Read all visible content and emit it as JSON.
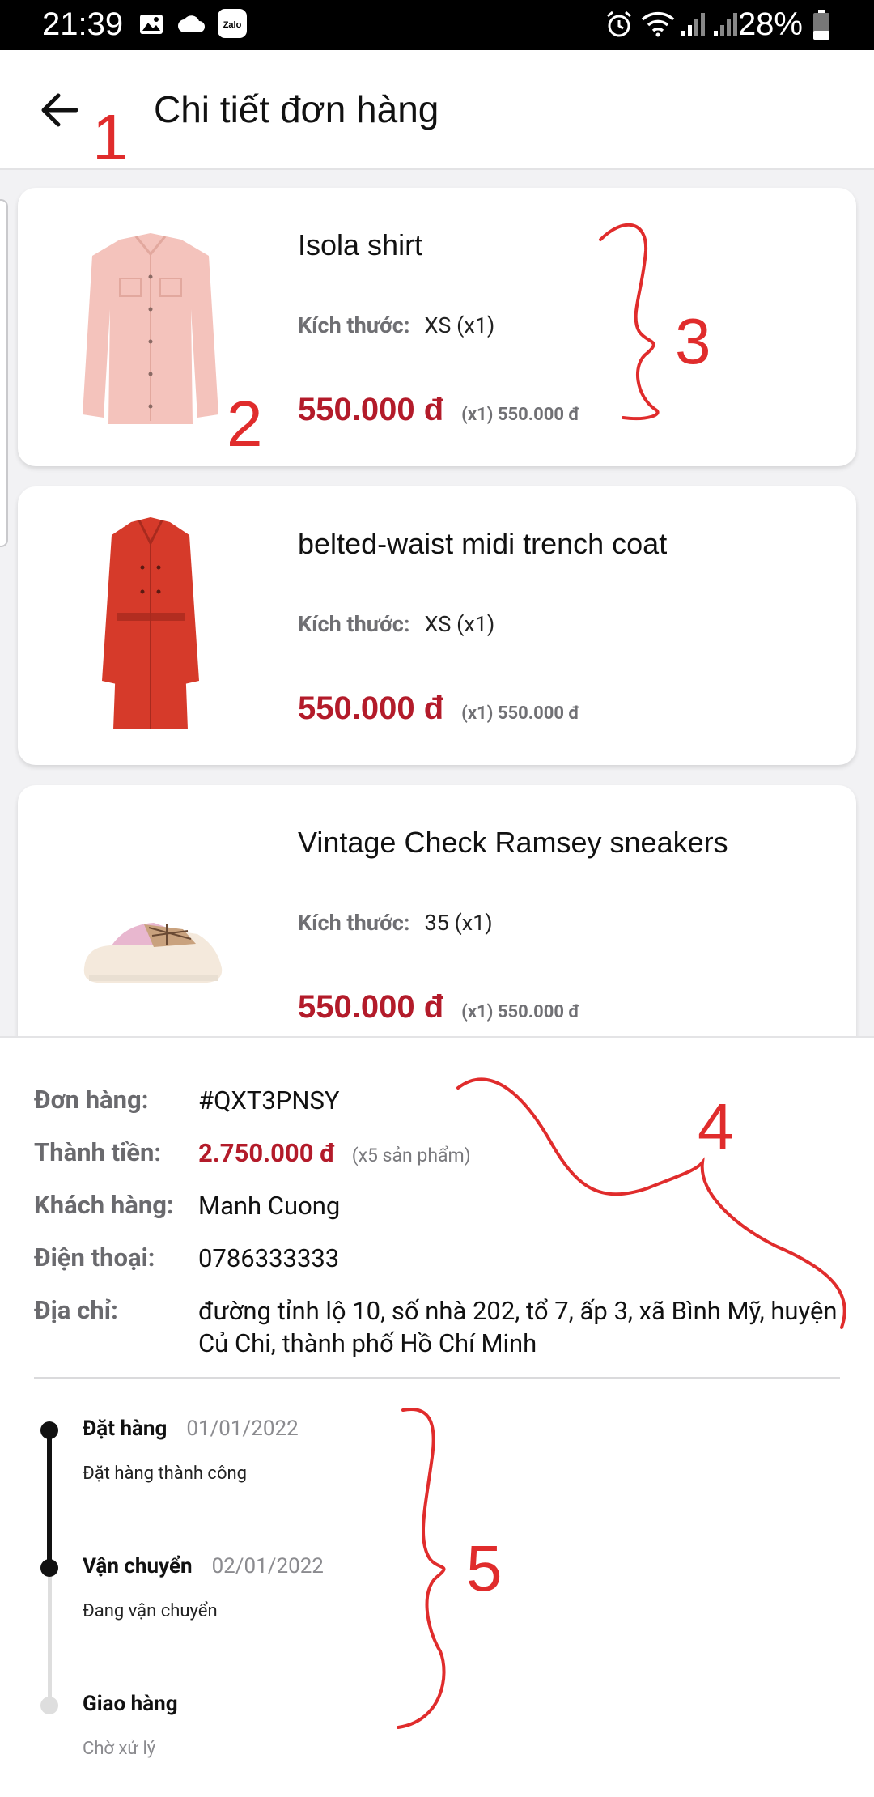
{
  "status_bar": {
    "time": "21:39",
    "battery": "28%"
  },
  "app_bar": {
    "title": "Chi tiết đơn hàng"
  },
  "products": [
    {
      "name": "Isola shirt",
      "size_label": "Kích thước:",
      "size_value": "XS (x1)",
      "price": "550.000 đ",
      "price_note": "(x1) 550.000 đ"
    },
    {
      "name": "belted-waist midi trench coat",
      "size_label": "Kích thước:",
      "size_value": "XS (x1)",
      "price": "550.000 đ",
      "price_note": "(x1) 550.000 đ"
    },
    {
      "name": "Vintage Check Ramsey sneakers",
      "size_label": "Kích thước:",
      "size_value": "35 (x1)",
      "price": "550.000 đ",
      "price_note": "(x1) 550.000 đ"
    }
  ],
  "order": {
    "order_label": "Đơn hàng:",
    "order_id": "#QXT3PNSY",
    "total_label": "Thành tiền:",
    "total": "2.750.000 đ",
    "count_note": "(x5 sản phẩm)",
    "customer_label": "Khách hàng:",
    "customer": "Manh Cuong",
    "phone_label": "Điện thoại:",
    "phone": "0786333333",
    "address_label": "Địa chỉ:",
    "address": "đường tỉnh lộ 10, số nhà 202, tổ 7, ấp 3, xã Bình Mỹ, huyện Củ Chi, thành phố Hồ Chí Minh"
  },
  "timeline": [
    {
      "name": "Đặt hàng",
      "date": "01/01/2022",
      "desc": "Đặt hàng thành công",
      "state": "done"
    },
    {
      "name": "Vận chuyển",
      "date": "02/01/2022",
      "desc": "Đang vận chuyển",
      "state": "current"
    },
    {
      "name": "Giao hàng",
      "date": "",
      "desc": "Chờ xử lý",
      "state": "pending"
    }
  ],
  "annotations": [
    "1",
    "2",
    "3",
    "4",
    "5"
  ],
  "colors": {
    "accent": "#b31b2a",
    "annotation": "#e02c2c",
    "list_bg": "#f2f2f4"
  },
  "icons": [
    "image-icon",
    "cloud-icon",
    "zalo-icon",
    "alarm-icon",
    "wifi-icon",
    "signal-icon",
    "battery-icon",
    "back-arrow-icon"
  ]
}
